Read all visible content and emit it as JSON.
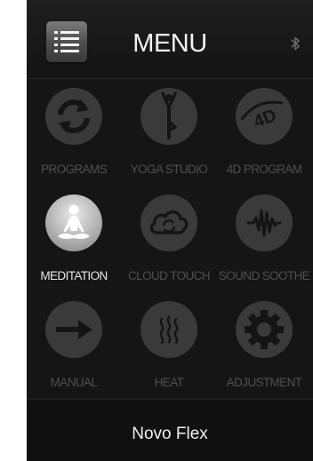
{
  "header": {
    "title": "MENU",
    "menu_icon": "list-icon",
    "bluetooth_icon": "bluetooth-icon"
  },
  "tiles": [
    {
      "label": "PROGRAMS",
      "icon": "refresh-icon",
      "active": false
    },
    {
      "label": "YOGA STUDIO",
      "icon": "yoga-icon",
      "active": false
    },
    {
      "label": "4D PROGRAM",
      "icon": "4d-icon",
      "active": false
    },
    {
      "label": "MEDITATION",
      "icon": "meditation-icon",
      "active": true
    },
    {
      "label": "CLOUD TOUCH",
      "icon": "cloud-icon",
      "active": false
    },
    {
      "label": "SOUND SOOTHE",
      "icon": "sound-wave-icon",
      "active": false
    },
    {
      "label": "MANUAL",
      "icon": "arrow-right-icon",
      "active": false
    },
    {
      "label": "HEAT",
      "icon": "heat-icon",
      "active": false
    },
    {
      "label": "ADJUSTMENT",
      "icon": "gear-icon",
      "active": false
    }
  ],
  "footer": {
    "device_name": "Novo Flex"
  },
  "colors": {
    "background": "#1b1b1b",
    "inactive_icon": "#3a3a3a",
    "inactive_label": "#4f4f4f",
    "active_label": "#e6e6e6"
  }
}
